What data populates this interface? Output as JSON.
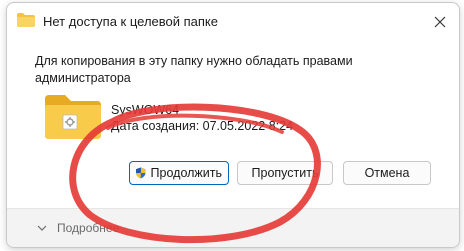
{
  "dialog": {
    "title": "Нет доступа к целевой папке",
    "message": "Для копирования в эту папку нужно обладать правами администратора",
    "file": {
      "name": "SysWOW64",
      "date": "Дата создания: 07.05.2022 8:24"
    },
    "buttons": {
      "continue": "Продолжить",
      "skip": "Пропустить",
      "cancel": "Отмена"
    },
    "details": "Подробнее"
  },
  "icons": {
    "title": "folder-icon",
    "close": "close-icon",
    "file": "folder-icon",
    "continue": "uac-shield-icon",
    "details": "chevron-down-icon"
  },
  "colors": {
    "accent": "#0067c0",
    "folder": "#f5c43a",
    "annotation": "#e53935"
  }
}
